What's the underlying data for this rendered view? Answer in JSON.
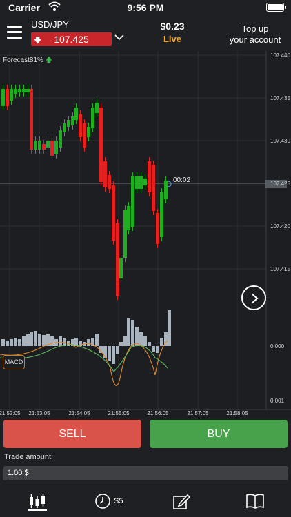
{
  "status_bar": {
    "carrier": "Carrier",
    "time": "9:56 PM"
  },
  "header": {
    "pair": "USD/JPY",
    "price": "107.425",
    "price_direction": "down",
    "balance": "$0.23",
    "account_mode": "Live",
    "topup_line1": "Top up",
    "topup_line2": "your account"
  },
  "chart": {
    "forecast_label": "Forecast",
    "forecast_value": "81%",
    "timer": "00:02",
    "current_price_tag": "107.425",
    "price_ticks": [
      "107.440",
      "107.435",
      "107.430",
      "107.425",
      "107.420",
      "107.415"
    ],
    "macd_ticks": [
      "0.000",
      "0.001"
    ],
    "time_ticks": [
      "21:52:05",
      "21:53:05",
      "21:54:05",
      "21:55:05",
      "21:56:05",
      "21:57:05",
      "21:58:05"
    ],
    "macd_label": "MACD",
    "colors": {
      "up": "#1fae1f",
      "down": "#e5201e",
      "macd_hist": "#a9b4bf",
      "macd_line": "#e08a2a",
      "signal_line": "#5cb85c"
    }
  },
  "actions": {
    "sell": "SELL",
    "buy": "BUY"
  },
  "trade": {
    "label": "Trade amount",
    "value": "1.00 $"
  },
  "tabbar": {
    "expiry_label": "S5",
    "icons": [
      "candles-icon",
      "clock-icon",
      "edit-icon",
      "book-icon"
    ]
  }
}
